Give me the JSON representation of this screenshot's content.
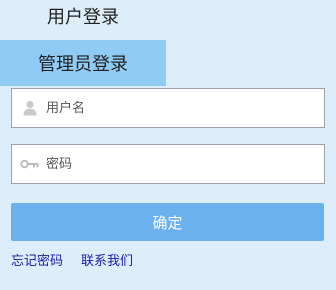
{
  "tabs": {
    "user_login": "用户登录",
    "admin_login": "管理员登录",
    "active": "admin_login"
  },
  "form": {
    "username": {
      "icon": "user-icon",
      "placeholder": "用户名",
      "value": ""
    },
    "password": {
      "icon": "key-icon",
      "placeholder": "密码",
      "value": ""
    },
    "submit_label": "确定"
  },
  "links": {
    "forgot_password": "忘记密码",
    "contact_us": "联系我们"
  },
  "colors": {
    "page_background": "#ddeefa",
    "active_tab": "#8fcbf3",
    "submit_button": "#6ab1ee",
    "link": "#1a1aa6"
  }
}
